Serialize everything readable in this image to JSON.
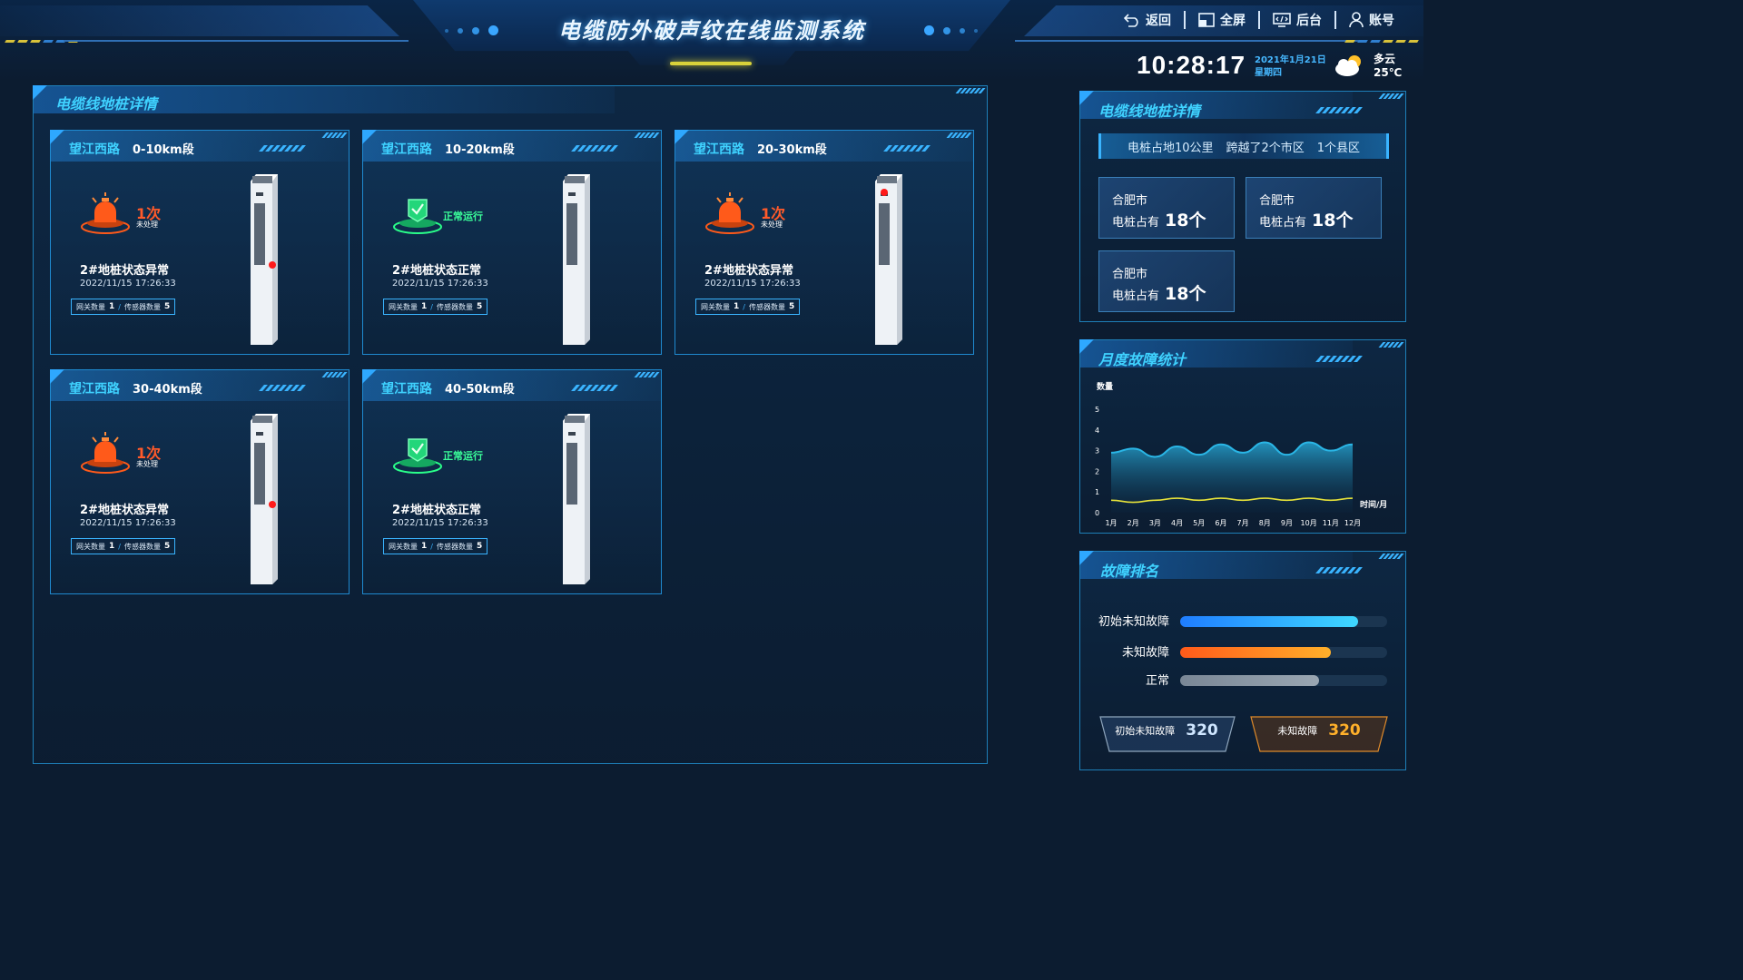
{
  "header": {
    "title": "电缆防外破声纹在线监测系统",
    "nav": [
      {
        "label": "返回",
        "icon": "back-icon"
      },
      {
        "label": "全屏",
        "icon": "fullscreen-icon"
      },
      {
        "label": "后台",
        "icon": "admin-icon"
      },
      {
        "label": "账号",
        "icon": "user-icon"
      }
    ],
    "clock": "10:28:17",
    "date": "2021年1月21日",
    "weekday": "星期四",
    "weather": "多云",
    "temperature": "25℃"
  },
  "main_panel": {
    "title": "电缆线地桩详情",
    "cards": [
      {
        "road": "望江西路",
        "segment": "0-10km段",
        "state": "alarm",
        "count": "1次",
        "count_sub": "未处理",
        "ok_text": "",
        "status": "2#地桩状态异常",
        "time": "2022/11/15 17:26:33",
        "gateway_label": "网关数量",
        "gateway": "1",
        "sensor_label": "传感器数量",
        "sensor": "5"
      },
      {
        "road": "望江西路",
        "segment": "10-20km段",
        "state": "ok",
        "count": "",
        "count_sub": "",
        "ok_text": "正常运行",
        "status": "2#地桩状态正常",
        "time": "2022/11/15 17:26:33",
        "gateway_label": "网关数量",
        "gateway": "1",
        "sensor_label": "传感器数量",
        "sensor": "5"
      },
      {
        "road": "望江西路",
        "segment": "20-30km段",
        "state": "alarm",
        "count": "1次",
        "count_sub": "未处理",
        "ok_text": "",
        "status": "2#地桩状态异常",
        "time": "2022/11/15 17:26:33",
        "gateway_label": "网关数量",
        "gateway": "1",
        "sensor_label": "传感器数量",
        "sensor": "5"
      },
      {
        "road": "望江西路",
        "segment": "30-40km段",
        "state": "alarm",
        "count": "1次",
        "count_sub": "未处理",
        "ok_text": "",
        "status": "2#地桩状态异常",
        "time": "2022/11/15 17:26:33",
        "gateway_label": "网关数量",
        "gateway": "1",
        "sensor_label": "传感器数量",
        "sensor": "5"
      },
      {
        "road": "望江西路",
        "segment": "40-50km段",
        "state": "ok",
        "count": "",
        "count_sub": "",
        "ok_text": "正常运行",
        "status": "2#地桩状态正常",
        "time": "2022/11/15 17:26:33",
        "gateway_label": "网关数量",
        "gateway": "1",
        "sensor_label": "传感器数量",
        "sensor": "5"
      }
    ]
  },
  "summary_panel": {
    "title": "电缆线地桩详情",
    "banner": [
      "电桩占地10公里",
      "跨越了2个市区",
      "1个县区"
    ],
    "cities": [
      {
        "name": "合肥市",
        "label": "电桩占有",
        "value": "18个"
      },
      {
        "name": "合肥市",
        "label": "电桩占有",
        "value": "18个"
      },
      {
        "name": "合肥市",
        "label": "电桩占有",
        "value": "18个"
      }
    ]
  },
  "fault_panel": {
    "title": "月度故障统计"
  },
  "chart_data": {
    "type": "area",
    "ylabel": "数量",
    "xlabel": "时间/月",
    "categories": [
      "1月",
      "2月",
      "3月",
      "4月",
      "5月",
      "6月",
      "7月",
      "8月",
      "9月",
      "10月",
      "11月",
      "12月"
    ],
    "ylim": [
      0,
      5
    ],
    "yticks": [
      0,
      1,
      2,
      3,
      4,
      5
    ],
    "series": [
      {
        "values": [
          2.9,
          3.1,
          2.7,
          3.2,
          2.8,
          3.3,
          2.9,
          3.4,
          2.8,
          3.4,
          3.0,
          3.3
        ],
        "color": "#2ab6e6"
      },
      {
        "values": [
          0.6,
          0.5,
          0.6,
          0.7,
          0.6,
          0.7,
          0.6,
          0.7,
          0.6,
          0.7,
          0.6,
          0.7
        ],
        "color": "#e6e23a"
      }
    ]
  },
  "rank_panel": {
    "title": "故障排名",
    "items": [
      {
        "label": "初始未知故障",
        "fraction": 0.86,
        "color_from": "#1f7dff",
        "color_to": "#3fd8ff"
      },
      {
        "label": "未知故障",
        "fraction": 0.73,
        "color_from": "#ff5a1a",
        "color_to": "#ffb02a"
      },
      {
        "label": "正常",
        "fraction": 0.67,
        "color_from": "#7a8796",
        "color_to": "#9aa6b2"
      }
    ],
    "badges": [
      {
        "label": "初始未知故障",
        "value": "320",
        "color": "#cfe6ff"
      },
      {
        "label": "未知故障",
        "value": "320",
        "color": "#ffb02a"
      }
    ]
  }
}
